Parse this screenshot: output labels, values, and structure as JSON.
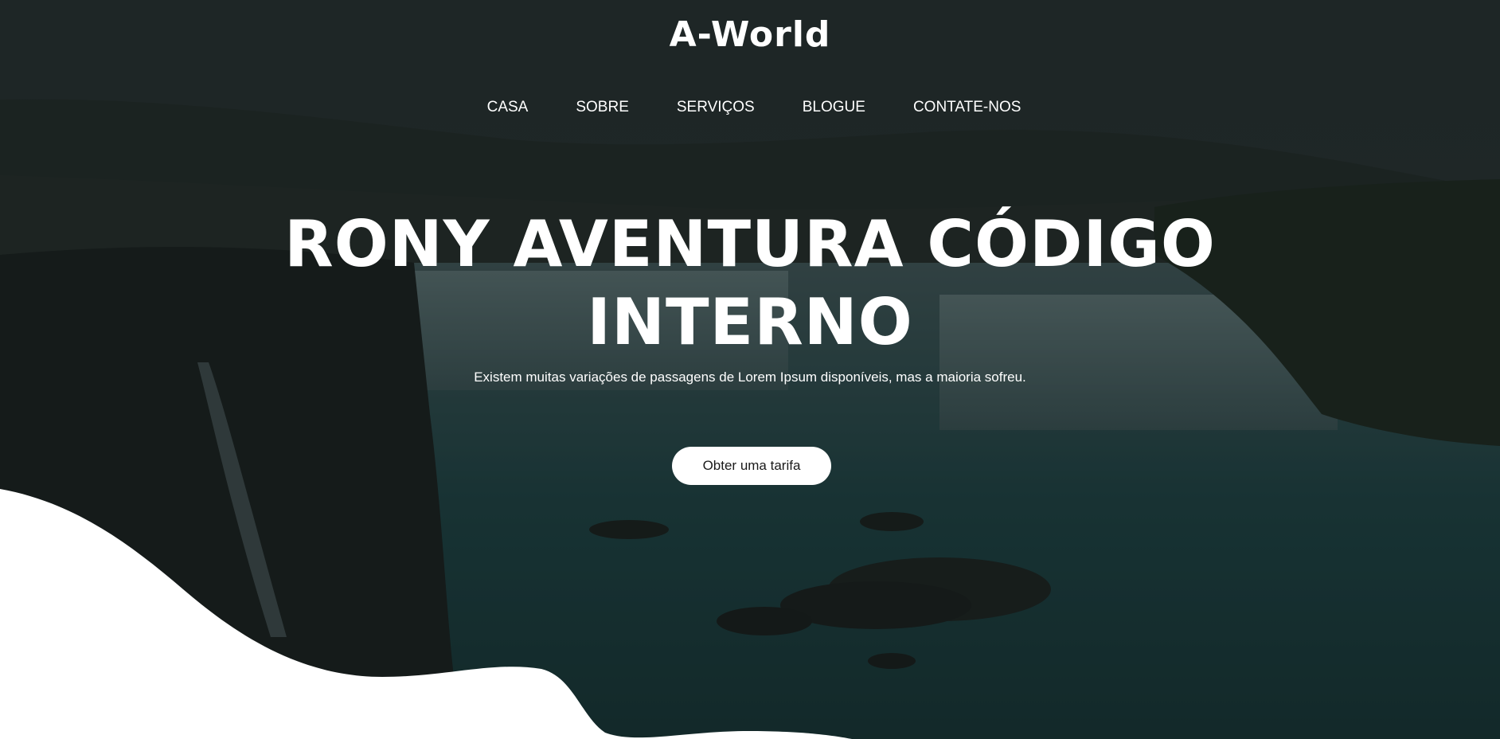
{
  "brand": {
    "logo_text": "A-World"
  },
  "nav": {
    "items": [
      {
        "label": "CASA"
      },
      {
        "label": "SOBRE"
      },
      {
        "label": "SERVIÇOS"
      },
      {
        "label": "BLOGUE"
      },
      {
        "label": "CONTATE-NOS"
      }
    ]
  },
  "hero": {
    "headline_line1": "RONY AVENTURA CÓDIGO",
    "headline_line2": "INTERNO",
    "subtext": "Existem muitas variações de passagens de Lorem Ipsum disponíveis, mas a maioria sofreu.",
    "cta_label": "Obter uma tarifa"
  },
  "colors": {
    "text": "#ffffff",
    "button_bg": "#ffffff",
    "wave": "#ffffff",
    "overlay": "#0f1616"
  }
}
